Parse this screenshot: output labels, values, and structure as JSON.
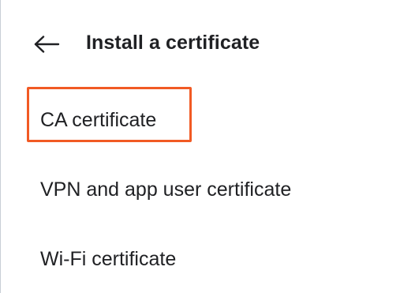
{
  "header": {
    "back_icon": "arrow-left-icon",
    "title": "Install a certificate"
  },
  "list": {
    "items": [
      {
        "label": "CA certificate",
        "highlighted": true
      },
      {
        "label": "VPN and app user certificate",
        "highlighted": false
      },
      {
        "label": "Wi-Fi certificate",
        "highlighted": false
      }
    ]
  },
  "colors": {
    "text": "#202124",
    "highlight_border": "#f15a24",
    "background": "#ffffff"
  }
}
